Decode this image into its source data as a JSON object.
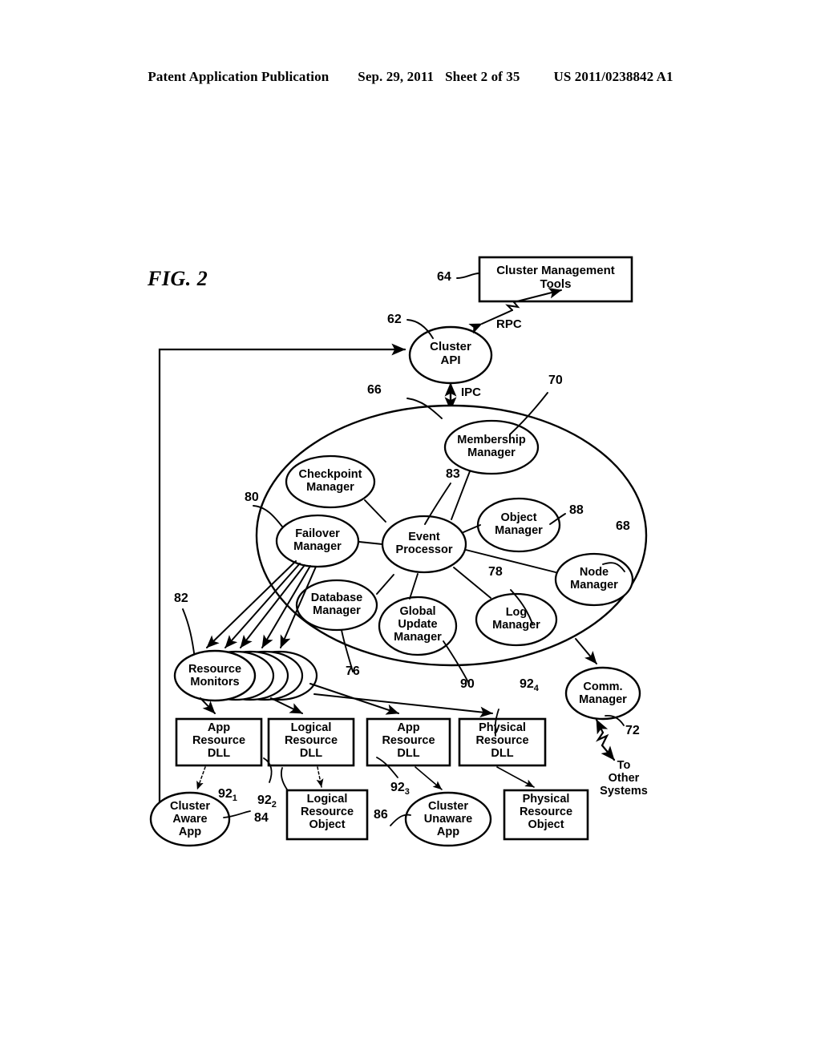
{
  "header": {
    "publication": "Patent Application Publication",
    "date": "Sep. 29, 2011",
    "sheet": "Sheet 2 of 35",
    "docnum": "US 2011/0238842 A1"
  },
  "figure": {
    "label": "FIG. 2"
  },
  "nodes": {
    "cluster_management_tools": "Cluster Management\nTools",
    "cluster_api": "Cluster\nAPI",
    "membership_manager": "Membership\nManager",
    "checkpoint_manager": "Checkpoint\nManager",
    "failover_manager": "Failover\nManager",
    "event_processor": "Event\nProcessor",
    "object_manager": "Object\nManager",
    "node_manager": "Node\nManager",
    "database_manager": "Database\nManager",
    "global_update_manager": "Global\nUpdate\nManager",
    "log_manager": "Log\nManager",
    "resource_monitors": "Resource\nMonitors",
    "comm_manager": "Comm.\nManager",
    "app_resource_dll_1": "App\nResource\nDLL",
    "logical_resource_dll": "Logical\nResource\nDLL",
    "app_resource_dll_2": "App\nResource\nDLL",
    "physical_resource_dll": "Physical\nResource\nDLL",
    "cluster_aware_app": "Cluster\nAware\nApp",
    "logical_resource_object": "Logical\nResource\nObject",
    "cluster_unaware_app": "Cluster\nUnaware\nApp",
    "physical_resource_object": "Physical\nResource\nObject"
  },
  "edge_labels": {
    "rpc": "RPC",
    "ipc": "IPC",
    "to_other_systems": "To\nOther\nSystems"
  },
  "ref_numerals": {
    "n62": "62",
    "n64": "64",
    "n66": "66",
    "n68": "68",
    "n70": "70",
    "n72": "72",
    "n76": "76",
    "n78": "78",
    "n80": "80",
    "n82": "82",
    "n83": "83",
    "n84": "84",
    "n86": "86",
    "n88": "88",
    "n90": "90",
    "n92_1_base": "92",
    "n92_1_sub": "1",
    "n92_2_base": "92",
    "n92_2_sub": "2",
    "n92_3_base": "92",
    "n92_3_sub": "3",
    "n92_4_base": "92",
    "n92_4_sub": "4"
  },
  "colors": {
    "ink": "#000000",
    "paper": "#ffffff"
  }
}
